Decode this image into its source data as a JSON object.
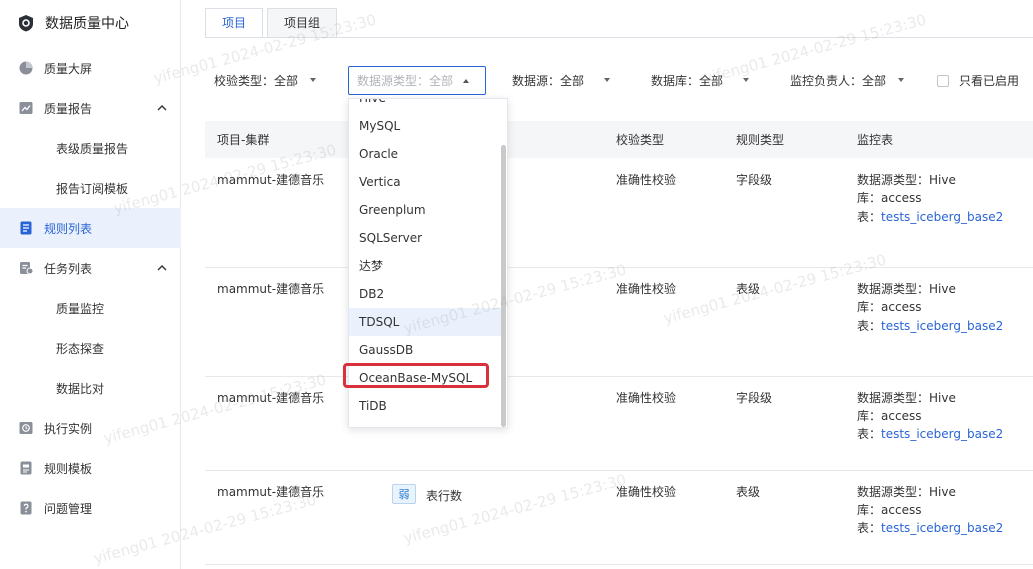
{
  "app": {
    "title": "数据质量中心"
  },
  "sidebar": {
    "items": [
      {
        "label": "质量大屏"
      },
      {
        "label": "质量报告"
      },
      {
        "label": "表级质量报告"
      },
      {
        "label": "报告订阅模板"
      },
      {
        "label": "规则列表"
      },
      {
        "label": "任务列表"
      },
      {
        "label": "质量监控"
      },
      {
        "label": "形态探查"
      },
      {
        "label": "数据比对"
      },
      {
        "label": "执行实例"
      },
      {
        "label": "规则模板"
      },
      {
        "label": "问题管理"
      }
    ]
  },
  "tabs": [
    {
      "label": "项目"
    },
    {
      "label": "项目组"
    }
  ],
  "filters": {
    "check_type": "校验类型：全部",
    "datasource_type_placeholder": "数据源类型：全部",
    "datasource": "数据源：全部",
    "database": "数据库：全部",
    "owner": "监控负责人：全部",
    "only_enabled": "只看已启用"
  },
  "table": {
    "headers": [
      "项目-集群",
      "校验类型",
      "规则类型",
      "监控表"
    ],
    "monitor_labels": {
      "ds_type": "数据源类型：",
      "db": "库：",
      "tbl": "表："
    },
    "rows": [
      {
        "project": "mammut-建德音乐",
        "check_type": "准确性校验",
        "rule_type": "字段级",
        "ds_type": "Hive",
        "db": "access",
        "tbl": "tests_iceberg_base2"
      },
      {
        "project": "mammut-建德音乐",
        "check_type": "准确性校验",
        "rule_type": "表级",
        "ds_type": "Hive",
        "db": "access",
        "tbl": "tests_iceberg_base2"
      },
      {
        "project": "mammut-建德音乐",
        "check_type": "准确性校验",
        "rule_type": "字段级",
        "ds_type": "Hive",
        "db": "access",
        "tbl": "tests_iceberg_base2"
      },
      {
        "project": "mammut-建德音乐",
        "tag": "弱",
        "rule_name": "表行数",
        "check_type": "准确性校验",
        "rule_type": "表级",
        "ds_type": "Hive",
        "db": "access",
        "tbl": "tests_iceberg_base2"
      }
    ]
  },
  "dropdown": {
    "options": [
      "Hive",
      "MySQL",
      "Oracle",
      "Vertica",
      "Greenplum",
      "SQLServer",
      "达梦",
      "DB2",
      "TDSQL",
      "GaussDB",
      "OceanBase-MySQL",
      "TiDB"
    ],
    "hovered": "TDSQL",
    "highlighted": "OceanBase-MySQL"
  },
  "watermark": "yifeng01 2024-02-29 15:23:30",
  "colors": {
    "accent": "#2964d6",
    "highlight": "#d9313c",
    "active_bg": "#eaf1fd"
  }
}
